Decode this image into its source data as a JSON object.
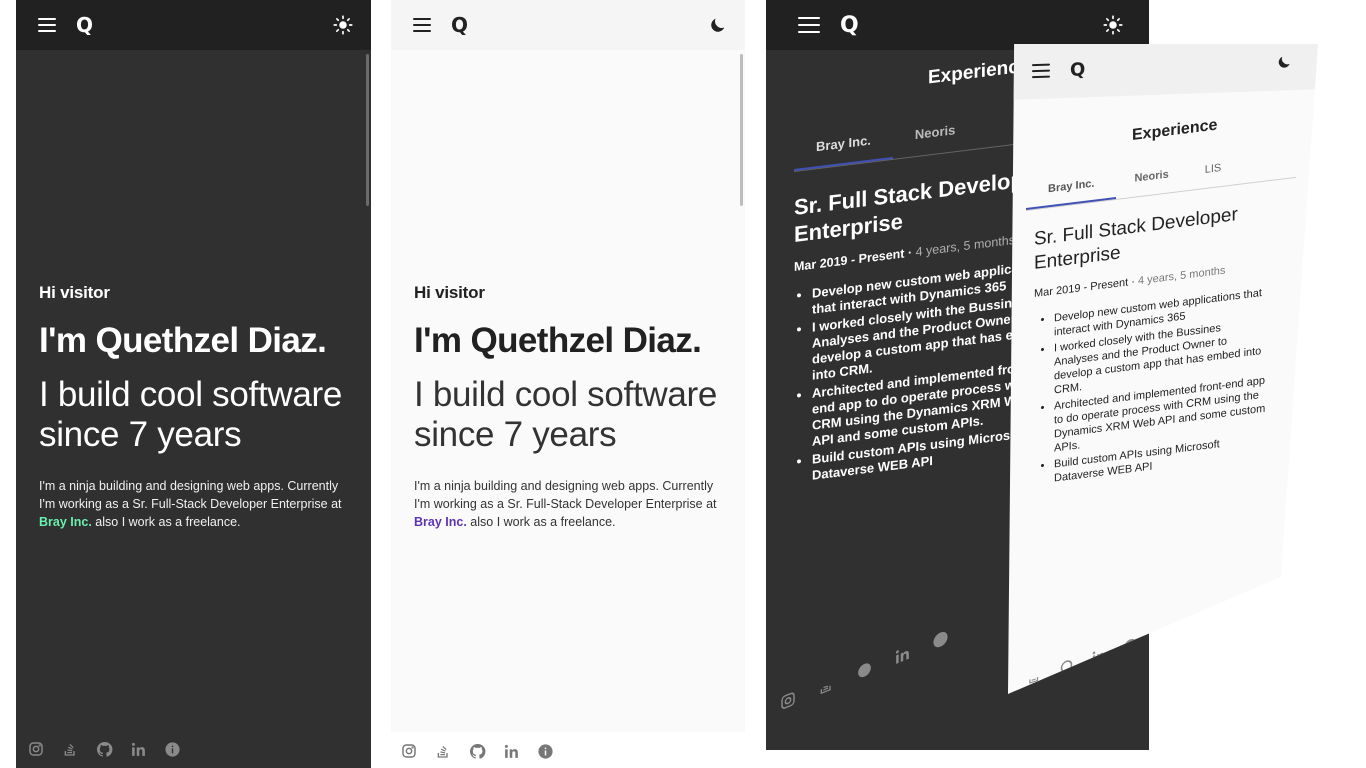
{
  "header": {
    "logo": "Q"
  },
  "hero": {
    "greeting": "Hi visitor",
    "name": "I'm Quethzel Diaz.",
    "tagline": "I build cool software since 7 years",
    "bio_before": "I'm a ninja building and designing web apps. Currently I'm working as a Sr. Full-Stack Developer Enterprise at",
    "bio_link": "Bray Inc.",
    "bio_after": "also I work as a freelance."
  },
  "experience": {
    "title": "Experience",
    "tabs": [
      "Bray Inc.",
      "Neoris",
      "LIS"
    ],
    "job_title": "Sr. Full Stack Developer Enterprise",
    "period": "Mar 2019 - Present",
    "duration": "4 years, 5 months",
    "duties": [
      "Develop new custom web applications that interact with Dynamics 365",
      "I worked closely with the Bussines Analyses and the Product Owner to develop a custom app that has embed into CRM.",
      "Architected and implemented front-end app to do operate process with CRM using the Dynamics XRM Web API and some custom APIs.",
      "Build custom APIs using Microsoft Dataverse WEB API"
    ],
    "back_title": "Experience",
    "back_tabs": [
      "Bray Inc.",
      "Neoris"
    ],
    "back_job_title": "Sr. Full Stack Developer Enterprise",
    "back_duties": [
      "Develop new custom web applications that interact with Dynamics 365",
      "I worked closely with the Bussines Analyses and the Product Owner to develop a custom app that has embed into CRM.",
      "Architected and implemented front-end app to do operate process with CRM using the Dynamics XRM Web API and some custom APIs.",
      "Build custom APIs using Microsoft Dataverse WEB API"
    ]
  },
  "socials": [
    "instagram-icon",
    "stackoverflow-icon",
    "github-icon",
    "linkedin-icon",
    "info-icon"
  ],
  "colors": {
    "dark_bg": "#303030",
    "dark_appbar": "#212121",
    "light_bg": "#fafafa",
    "dark_link": "#69f0ae",
    "light_link": "#5e35b1",
    "tab_indicator": "#3f51b5"
  }
}
